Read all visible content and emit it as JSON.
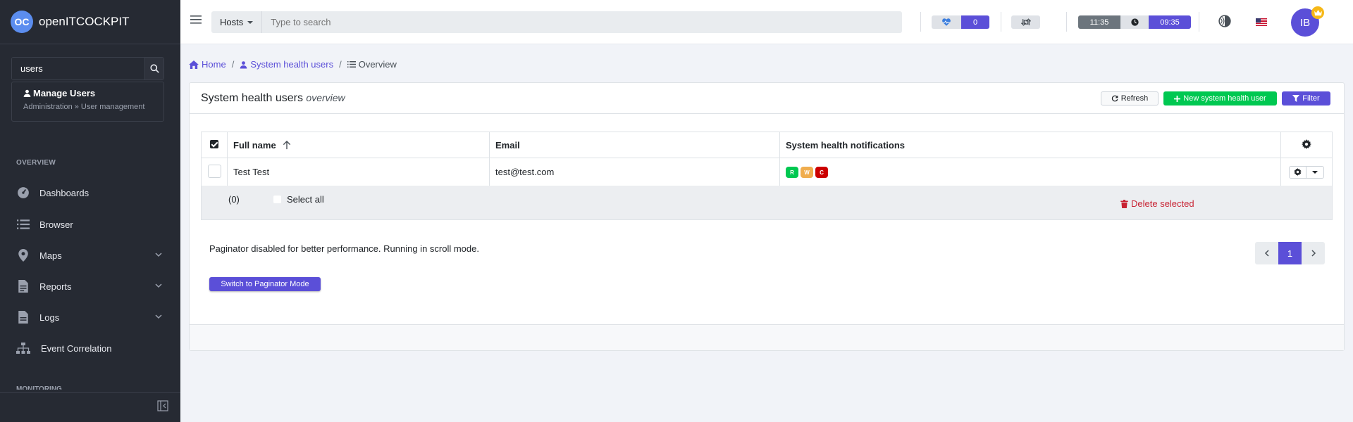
{
  "sidebar": {
    "brand_logo_text": "OC",
    "brand_name": "openITCOCKPIT",
    "search_value": "users",
    "search_result": {
      "title": "Manage Users",
      "path": "Administration » User management"
    },
    "section_label": "OVERVIEW",
    "items": [
      {
        "label": "Dashboards"
      },
      {
        "label": "Browser"
      },
      {
        "label": "Maps"
      },
      {
        "label": "Reports"
      },
      {
        "label": "Logs"
      },
      {
        "label": "Event Correlation"
      }
    ],
    "next_section_label": "MONITORING"
  },
  "header": {
    "search_scope": "Hosts",
    "search_placeholder": "Type to search",
    "health_count": "0",
    "local_time": "11:35",
    "server_time": "09:35",
    "avatar_initials": "IB"
  },
  "breadcrumb": {
    "home": "Home",
    "section": "System health users",
    "current": "Overview"
  },
  "card": {
    "title": "System health users",
    "subtitle": "overview",
    "refresh_label": "Refresh",
    "new_label": "New system health user",
    "filter_label": "Filter"
  },
  "table": {
    "columns": {
      "full_name": "Full name",
      "email": "Email",
      "notifications": "System health notifications"
    },
    "rows": [
      {
        "full_name": "Test Test",
        "email": "test@test.com",
        "tags": [
          "R",
          "W",
          "C"
        ]
      }
    ]
  },
  "selection": {
    "count": "(0)",
    "select_all_label": "Select all",
    "delete_label": "Delete selected"
  },
  "pagination": {
    "info": "Paginator disabled for better performance. Running in scroll mode.",
    "current_page": "1",
    "switch_label": "Switch to Paginator Mode"
  },
  "colors": {
    "primary": "#5b4fd8",
    "success": "#00c851",
    "danger": "#c82333",
    "tag_recovery": "#00c851",
    "tag_warning": "#f0ad4e",
    "tag_critical": "#cc0000"
  }
}
